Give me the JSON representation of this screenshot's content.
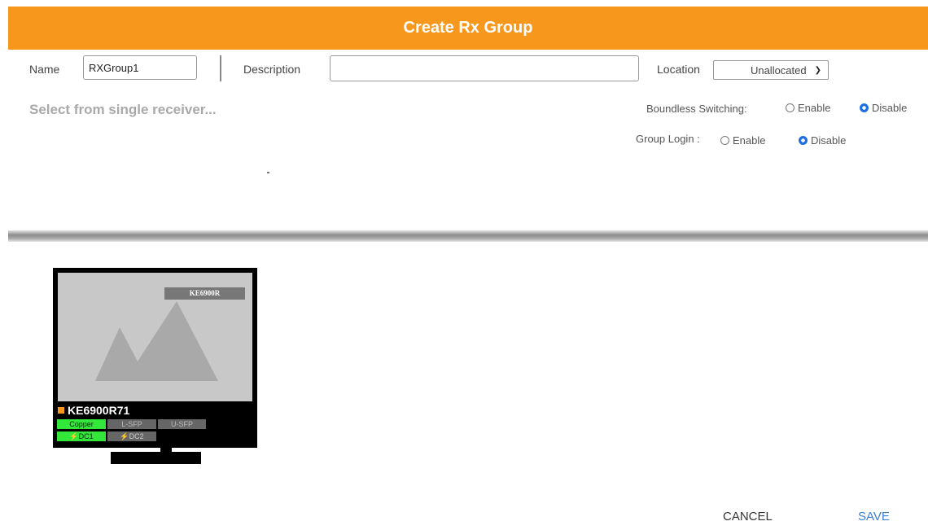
{
  "header": {
    "title": "Create Rx Group"
  },
  "form": {
    "name_label": "Name",
    "name_value": "RXGroup1",
    "description_label": "Description",
    "description_value": "",
    "location_label": "Location",
    "location_selected": "Unallocated"
  },
  "select_text": "Select from single receiver...",
  "boundless_switching": {
    "label": "Boundless Switching:",
    "enable": "Enable",
    "disable": "Disable",
    "selected": "Disable"
  },
  "group_login": {
    "label": "Group Login :",
    "enable": "Enable",
    "disable": "Disable",
    "selected": "Disable"
  },
  "receiver": {
    "model_tag": "KE6900R",
    "name": "KE6900R71",
    "ports_row1": [
      "Copper",
      "L-SFP",
      "U-SFP"
    ],
    "ports_row2": [
      "DC1",
      "DC2"
    ]
  },
  "colors": {
    "header": "#f7981d",
    "accent": "#3b7fd0",
    "port_active": "#33e63a"
  },
  "actions": {
    "cancel": "CANCEL",
    "save": "SAVE"
  }
}
